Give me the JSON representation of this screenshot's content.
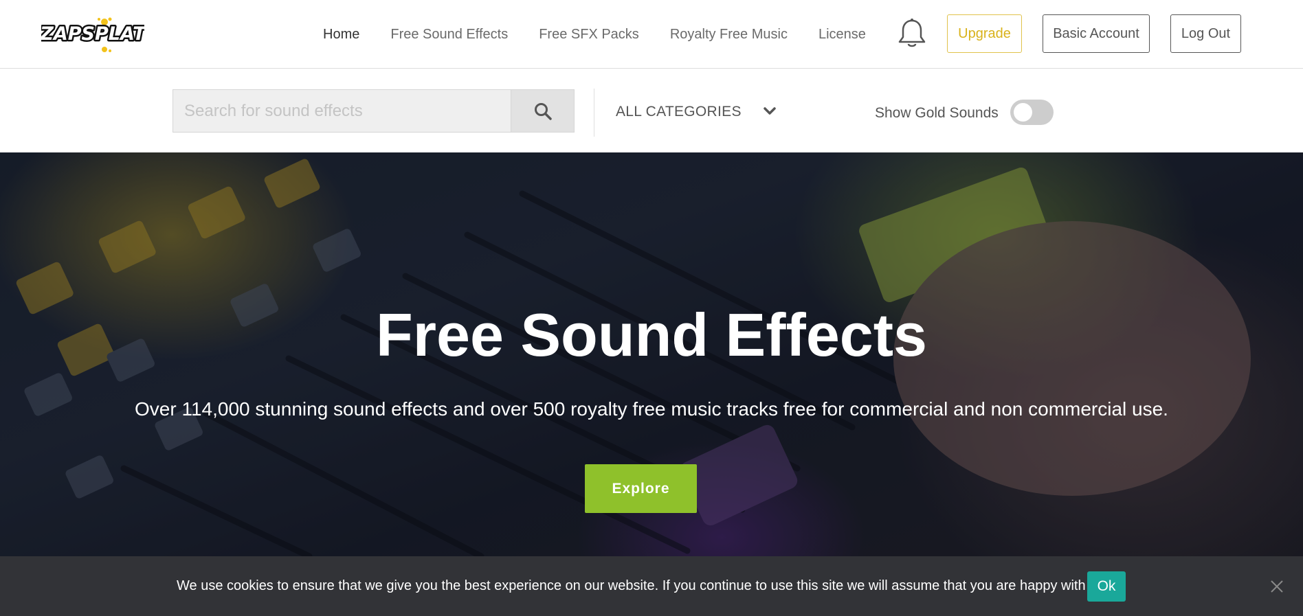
{
  "header": {
    "logo_text": "ZAPSPLAT",
    "nav": [
      "Home",
      "Free Sound Effects",
      "Free SFX Packs",
      "Royalty Free Music",
      "License"
    ],
    "active_nav": "Home",
    "notification_icon": "bell-icon",
    "upgrade_label": "Upgrade",
    "account_label": "Basic Account",
    "logout_label": "Log Out"
  },
  "search": {
    "placeholder": "Search for sound effects",
    "value": "",
    "button_icon": "search-icon",
    "category_selected": "ALL CATEGORIES",
    "category_icon": "chevron-down-icon",
    "gold_label": "Show Gold Sounds",
    "gold_enabled": false
  },
  "hero": {
    "title": "Free Sound Effects",
    "subtitle": "Over 114,000 stunning sound effects and over 500 royalty free music tracks free for commercial and non commercial use.",
    "cta_label": "Explore"
  },
  "cookie_notice": {
    "text": "We use cookies to ensure that we give you the best experience on our website. If you continue to use this site we will assume that you are happy with it.",
    "ok_label": "Ok",
    "close_icon": "close-icon"
  },
  "colors": {
    "upgrade": "#d9b21a",
    "explore": "#8fc12b",
    "cookie_ok": "#1aa89a",
    "cookie_bg": "#323337"
  }
}
